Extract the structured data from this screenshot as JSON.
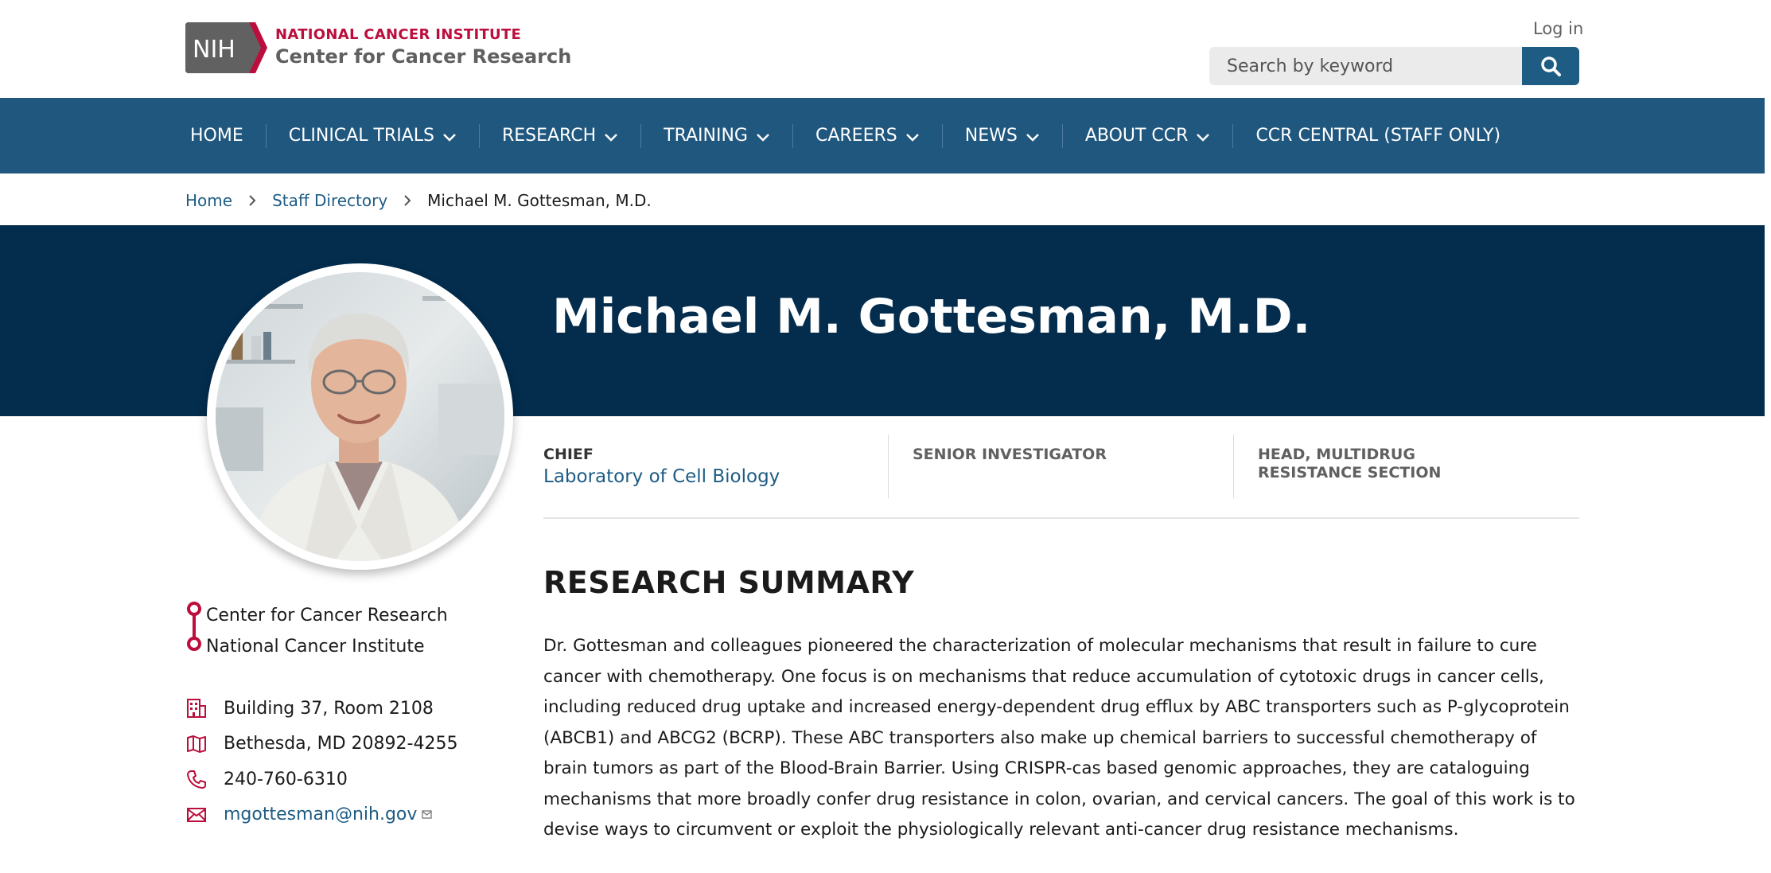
{
  "header": {
    "logo_mark": "NIH",
    "logo_line1": "NATIONAL CANCER INSTITUTE",
    "logo_line2": "Center for Cancer Research",
    "login_label": "Log in",
    "search_placeholder": "Search by keyword"
  },
  "nav": {
    "items": [
      {
        "label": "HOME"
      },
      {
        "label": "CLINICAL TRIALS"
      },
      {
        "label": "RESEARCH"
      },
      {
        "label": "TRAINING"
      },
      {
        "label": "CAREERS"
      },
      {
        "label": "NEWS"
      },
      {
        "label": "ABOUT CCR"
      },
      {
        "label": "CCR CENTRAL (STAFF ONLY)"
      }
    ]
  },
  "breadcrumb": {
    "home": "Home",
    "directory": "Staff Directory",
    "current": "Michael M. Gottesman, M.D."
  },
  "profile": {
    "name": "Michael M. Gottesman, M.D.",
    "titles": [
      {
        "role": "CHIEF",
        "link": "Laboratory of Cell Biology"
      },
      {
        "role": "SENIOR INVESTIGATOR"
      },
      {
        "role": "HEAD, MULTIDRUG RESISTANCE SECTION"
      }
    ],
    "org": [
      "Center for Cancer Research",
      "National Cancer Institute"
    ],
    "contact": {
      "building": "Building 37, Room 2108",
      "city": "Bethesda, MD 20892-4255",
      "phone": "240-760-6310",
      "email": "mgottesman@nih.gov"
    }
  },
  "research": {
    "heading": "RESEARCH SUMMARY",
    "summary": "Dr. Gottesman and colleagues pioneered the characterization of molecular mechanisms that result in failure to cure cancer with chemotherapy.  One focus is on mechanisms that reduce accumulation of cytotoxic drugs in cancer cells, including reduced drug uptake and increased energy-dependent drug efflux by ABC transporters such as P-glycoprotein (ABCB1) and ABCG2 (BCRP).  These ABC transporters also make up chemical barriers to successful chemotherapy of brain tumors as part of the Blood-Brain Barrier. Using CRISPR-cas based genomic approaches, they are cataloguing mechanisms that more broadly confer drug resistance in colon, ovarian, and cervical cancers. The goal of this work is to devise ways to circumvent or exploit the physiologically relevant anti-cancer drug resistance mechanisms."
  },
  "colors": {
    "nav_blue": "#20577f",
    "hero_navy": "#032c4d",
    "brand_red": "#bb0e3d",
    "link_blue": "#1e5c84"
  }
}
